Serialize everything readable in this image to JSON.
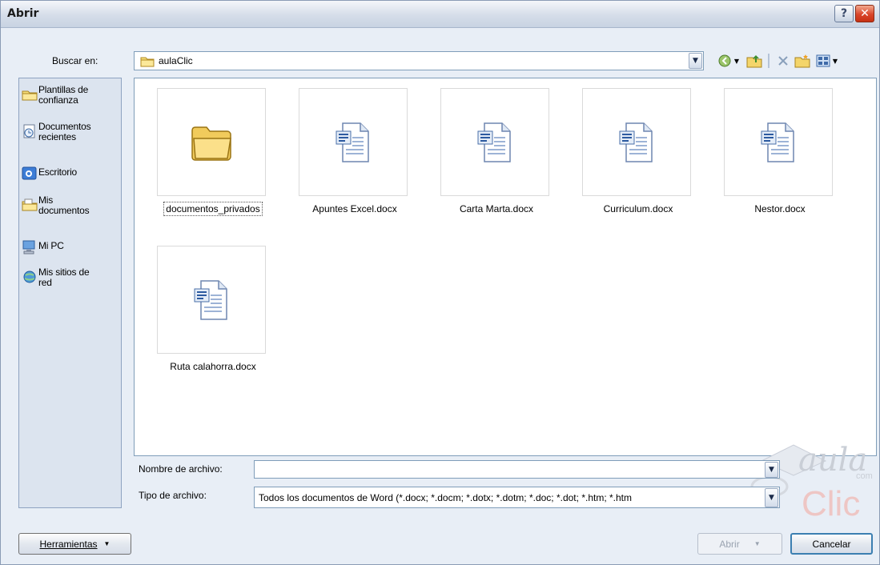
{
  "window": {
    "title": "Abrir",
    "help_label": "?",
    "close_label": "✕"
  },
  "look_in": {
    "label": "Buscar en:",
    "value": "aulaClic"
  },
  "places": [
    {
      "label": "Plantillas de confianza",
      "icon": "folder-icon"
    },
    {
      "label": "Documentos recientes",
      "icon": "recent-documents-icon"
    },
    {
      "label": "Escritorio",
      "icon": "desktop-icon"
    },
    {
      "label": "Mis documentos",
      "icon": "my-documents-icon"
    },
    {
      "label": "Mi PC",
      "icon": "computer-icon"
    },
    {
      "label": "Mis sitios de red",
      "icon": "network-icon"
    }
  ],
  "files": [
    {
      "name": "documentos_privados",
      "type": "folder",
      "selected": true
    },
    {
      "name": "Apuntes Excel.docx",
      "type": "docx"
    },
    {
      "name": "Carta Marta.docx",
      "type": "docx"
    },
    {
      "name": "Curriculum.docx",
      "type": "docx"
    },
    {
      "name": "Nestor.docx",
      "type": "docx"
    },
    {
      "name": "Ruta calahorra.docx",
      "type": "docx"
    }
  ],
  "filename": {
    "label": "Nombre de archivo:",
    "value": ""
  },
  "filetype": {
    "label": "Tipo de archivo:",
    "value": "Todos los documentos de Word (*.docx; *.docm; *.dotx; *.dotm; *.doc; *.dot; *.htm; *.htm"
  },
  "buttons": {
    "tools": "Herramientas",
    "open": "Abrir",
    "cancel": "Cancelar"
  },
  "watermark": {
    "line1": "aula",
    "line2": "Clic",
    "small": "com"
  },
  "colors": {
    "accent": "#3c7fb1",
    "pane_bg": "#dce4ef",
    "window_bg": "#e8eef6"
  }
}
